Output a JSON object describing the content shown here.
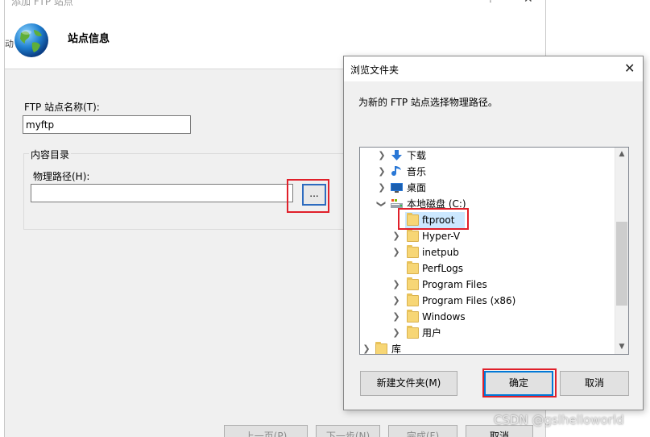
{
  "wizard": {
    "title": "添加 FTP 站点",
    "help_glyph": "?",
    "close_glyph": "✕",
    "header_title": "站点信息",
    "left_edge_text": "动",
    "site_name_label": "FTP 站点名称(T):",
    "site_name_value": "myftp",
    "content_dir_label": "内容目录",
    "physical_path_label": "物理路径(H):",
    "physical_path_value": "",
    "browse_button_label": "...",
    "buttons": {
      "prev": "上一页(P)",
      "next": "下一步(N)",
      "finish": "完成(F)",
      "cancel": "取消"
    }
  },
  "browse_dialog": {
    "title": "浏览文件夹",
    "close_glyph": "✕",
    "instruction": "为新的 FTP 站点选择物理路径。",
    "tree": [
      {
        "label": "下载",
        "icon": "download-arrow-icon",
        "expander": "collapsed"
      },
      {
        "label": "音乐",
        "icon": "music-note-icon",
        "expander": "collapsed"
      },
      {
        "label": "桌面",
        "icon": "desktop-icon",
        "expander": "collapsed"
      },
      {
        "label": "本地磁盘 (C:)",
        "icon": "disk-drive-icon",
        "expander": "expanded"
      },
      {
        "label": "ftproot",
        "icon": "folder-icon",
        "expander": "none",
        "selected": true
      },
      {
        "label": "Hyper-V",
        "icon": "folder-icon",
        "expander": "collapsed"
      },
      {
        "label": "inetpub",
        "icon": "folder-icon",
        "expander": "collapsed"
      },
      {
        "label": "PerfLogs",
        "icon": "folder-icon",
        "expander": "none"
      },
      {
        "label": "Program Files",
        "icon": "folder-icon",
        "expander": "collapsed"
      },
      {
        "label": "Program Files (x86)",
        "icon": "folder-icon",
        "expander": "collapsed"
      },
      {
        "label": "Windows",
        "icon": "folder-icon",
        "expander": "collapsed"
      },
      {
        "label": "用户",
        "icon": "folder-icon",
        "expander": "collapsed"
      },
      {
        "label": "库",
        "icon": "library-icon",
        "expander": "collapsed"
      }
    ],
    "buttons": {
      "new_folder": "新建文件夹(M)",
      "ok": "确定",
      "cancel": "取消"
    }
  },
  "watermark": "CSDN @gslhelloworld",
  "colors": {
    "highlight_red": "#e0202a",
    "selection_blue": "#cce8ff",
    "focus_blue": "#0078d7",
    "folder_yellow": "#f7d675"
  }
}
